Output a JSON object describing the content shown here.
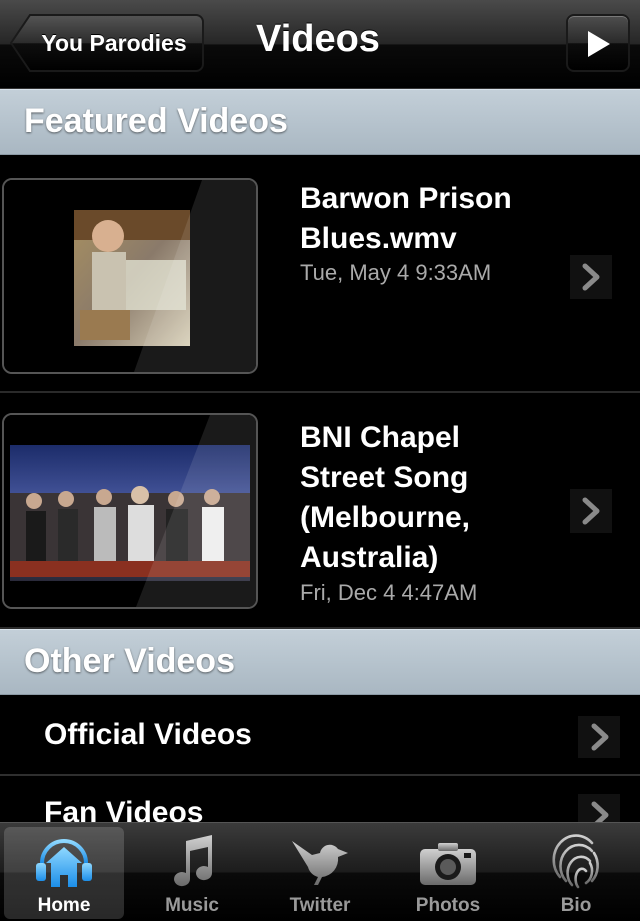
{
  "navbar": {
    "back_label": "You Parodies",
    "title": "Videos",
    "play_icon": "play-icon"
  },
  "sections": {
    "featured": "Featured Videos",
    "other": "Other Videos"
  },
  "featured_videos": [
    {
      "title_lines": [
        "Barwon Prison",
        "Blues.wmv"
      ],
      "date": "Tue, May 4 9:33AM"
    },
    {
      "title_lines": [
        "BNI Chapel",
        "Street Song",
        "(Melbourne,",
        "Australia)"
      ],
      "date": "Fri, Dec 4 4:47AM"
    }
  ],
  "other_videos": [
    {
      "label": "Official Videos"
    },
    {
      "label": "Fan Videos"
    }
  ],
  "tabs": [
    {
      "label": "Home",
      "icon": "home-icon",
      "active": true
    },
    {
      "label": "Music",
      "icon": "music-note-icon",
      "active": false
    },
    {
      "label": "Twitter",
      "icon": "bird-icon",
      "active": false
    },
    {
      "label": "Photos",
      "icon": "camera-icon",
      "active": false
    },
    {
      "label": "Bio",
      "icon": "fingerprint-icon",
      "active": false
    }
  ],
  "colors": {
    "section_header": "#b4c1cb",
    "home_icon": "#3fb0ff"
  }
}
